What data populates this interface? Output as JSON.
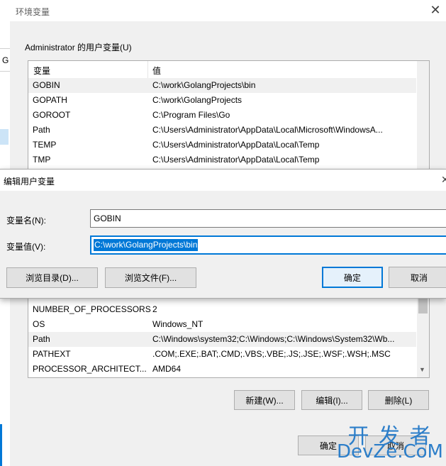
{
  "back_window": {
    "side_text": "G"
  },
  "env_window": {
    "title": "环境变量",
    "user_group_label": "Administrator 的用户变量(U)",
    "col_name": "变量",
    "col_value": "值",
    "user_vars": [
      {
        "name": "GOBIN",
        "value": "C:\\work\\GolangProjects\\bin"
      },
      {
        "name": "GOPATH",
        "value": "C:\\work\\GolangProjects"
      },
      {
        "name": "GOROOT",
        "value": "C:\\Program Files\\Go"
      },
      {
        "name": "Path",
        "value": "C:\\Users\\Administrator\\AppData\\Local\\Microsoft\\WindowsA..."
      },
      {
        "name": "TEMP",
        "value": "C:\\Users\\Administrator\\AppData\\Local\\Temp"
      },
      {
        "name": "TMP",
        "value": "C:\\Users\\Administrator\\AppData\\Local\\Temp"
      }
    ],
    "system_vars": [
      {
        "name": "NUMBER_OF_PROCESSORS",
        "value": "2"
      },
      {
        "name": "OS",
        "value": "Windows_NT"
      },
      {
        "name": "Path",
        "value": "C:\\Windows\\system32;C:\\Windows;C:\\Windows\\System32\\Wb..."
      },
      {
        "name": "PATHEXT",
        "value": ".COM;.EXE;.BAT;.CMD;.VBS;.VBE;.JS;.JSE;.WSF;.WSH;.MSC"
      },
      {
        "name": "PROCESSOR_ARCHITECT...",
        "value": "AMD64"
      }
    ],
    "btn_new": "新建(W)...",
    "btn_edit": "编辑(I)...",
    "btn_delete": "删除(L)",
    "btn_ok": "确定",
    "btn_cancel": "取消"
  },
  "edit_dialog": {
    "title": "编辑用户变量",
    "name_label": "变量名(N):",
    "name_value": "GOBIN",
    "value_label": "变量值(V):",
    "value_value": "C:\\work\\GolangProjects\\bin",
    "btn_browse_dir": "浏览目录(D)...",
    "btn_browse_file": "浏览文件(F)...",
    "btn_ok": "确定",
    "btn_cancel": "取消"
  },
  "watermark": {
    "line1": "开 发 者",
    "line2": "DevZe.CoM"
  },
  "colors": {
    "accent": "#0078d7",
    "selection": "#0078d7"
  }
}
